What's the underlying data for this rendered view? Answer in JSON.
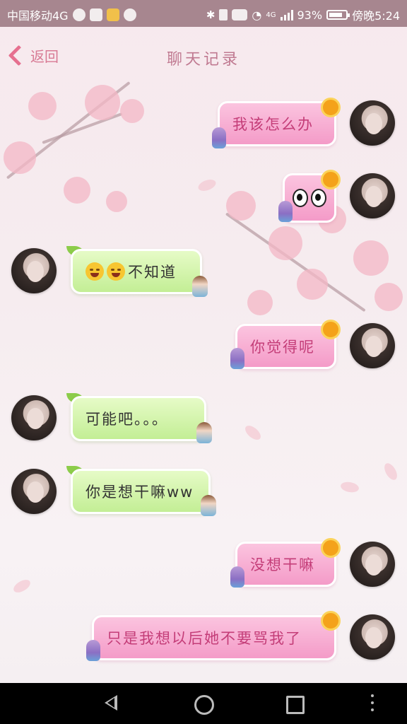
{
  "status_bar": {
    "carrier": "中国移动4G",
    "network": "4G",
    "battery": "93%",
    "time": "傍晚5:24"
  },
  "header": {
    "back_label": "返回",
    "title": "聊天记录"
  },
  "messages": [
    {
      "side": "right",
      "text": "我该怎么办"
    },
    {
      "side": "right",
      "text": "",
      "sticker": "eyes"
    },
    {
      "side": "left",
      "text": "不知道",
      "emoji": "tears-of-joy x2"
    },
    {
      "side": "right",
      "text": "你觉得呢"
    },
    {
      "side": "left",
      "text": "可能吧。。。"
    },
    {
      "side": "left",
      "text": "你是想干嘛ww"
    },
    {
      "side": "right",
      "text": "没想干嘛"
    },
    {
      "side": "right",
      "text": "只是我想以后她不要骂我了"
    }
  ],
  "colors": {
    "status_bar": "#a7868f",
    "pink_bubble": "#f49bc8",
    "green_bubble": "#c3ee95",
    "accent": "#e6708f"
  },
  "nav_icons": [
    "back-icon",
    "home-icon",
    "recents-icon",
    "more-icon"
  ]
}
